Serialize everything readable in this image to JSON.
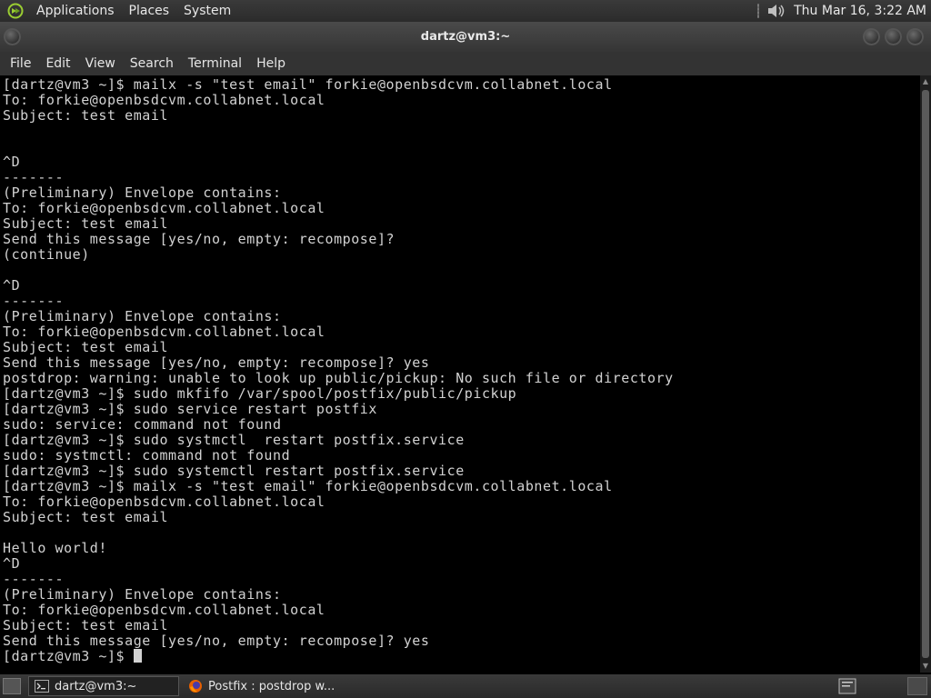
{
  "top_panel": {
    "menus": [
      "Applications",
      "Places",
      "System"
    ],
    "clock": "Thu Mar 16,  3:22 AM",
    "icons": {
      "logo": "distro-logo-icon",
      "volume": "volume-icon"
    }
  },
  "window": {
    "title": "dartz@vm3:~",
    "menubar": [
      "File",
      "Edit",
      "View",
      "Search",
      "Terminal",
      "Help"
    ]
  },
  "terminal": {
    "lines": [
      "[dartz@vm3 ~]$ mailx -s \"test email\" forkie@openbsdcvm.collabnet.local",
      "To: forkie@openbsdcvm.collabnet.local",
      "Subject: test email",
      "",
      "",
      "^D",
      "-------",
      "(Preliminary) Envelope contains:",
      "To: forkie@openbsdcvm.collabnet.local",
      "Subject: test email",
      "Send this message [yes/no, empty: recompose]?",
      "(continue)",
      "",
      "^D",
      "-------",
      "(Preliminary) Envelope contains:",
      "To: forkie@openbsdcvm.collabnet.local",
      "Subject: test email",
      "Send this message [yes/no, empty: recompose]? yes",
      "postdrop: warning: unable to look up public/pickup: No such file or directory",
      "[dartz@vm3 ~]$ sudo mkfifo /var/spool/postfix/public/pickup",
      "[dartz@vm3 ~]$ sudo service restart postfix",
      "sudo: service: command not found",
      "[dartz@vm3 ~]$ sudo systmctl  restart postfix.service",
      "sudo: systmctl: command not found",
      "[dartz@vm3 ~]$ sudo systemctl restart postfix.service",
      "[dartz@vm3 ~]$ mailx -s \"test email\" forkie@openbsdcvm.collabnet.local",
      "To: forkie@openbsdcvm.collabnet.local",
      "Subject: test email",
      "",
      "Hello world!",
      "^D",
      "-------",
      "(Preliminary) Envelope contains:",
      "To: forkie@openbsdcvm.collabnet.local",
      "Subject: test email",
      "Send this message [yes/no, empty: recompose]? yes",
      "[dartz@vm3 ~]$ "
    ],
    "text_color": "#d2d2d2",
    "background": "#000000"
  },
  "taskbar": {
    "tasks": [
      {
        "label": "dartz@vm3:~",
        "icon": "terminal-icon",
        "active": true
      },
      {
        "label": "Postfix : postdrop w...",
        "icon": "firefox-icon",
        "active": false
      }
    ],
    "icons": {
      "show_desktop": "show-desktop-icon",
      "notification": "notification-icon",
      "workspace": "workspace-switcher-icon"
    }
  }
}
